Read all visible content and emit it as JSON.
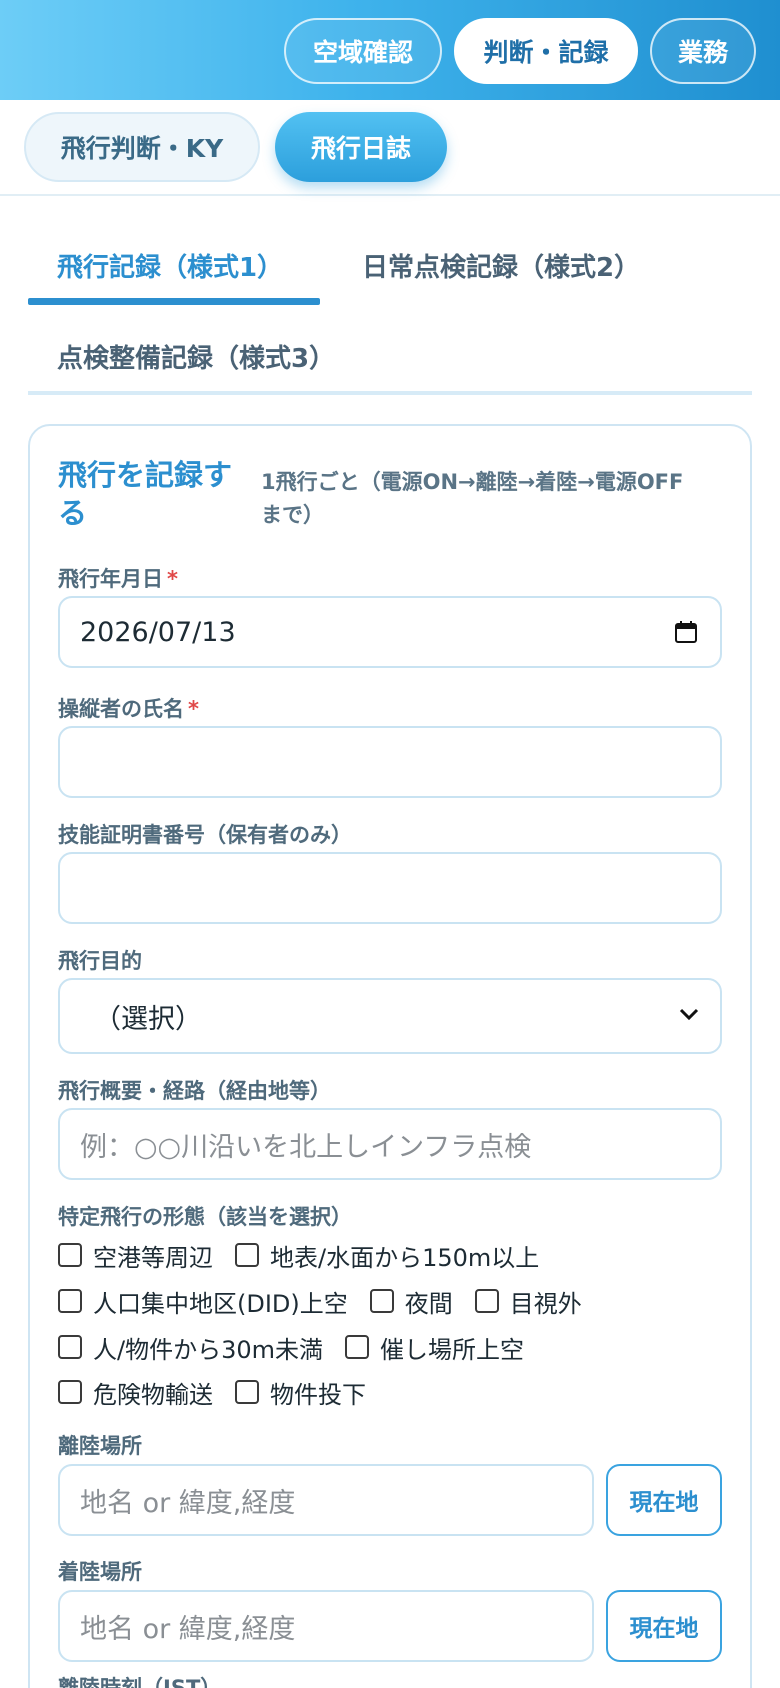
{
  "header": {
    "nav": [
      "空域確認",
      "判断・記録",
      "業務"
    ],
    "active_index": 1
  },
  "subnav": {
    "tabs": [
      "飛行判断・KY",
      "飛行日誌"
    ],
    "active_index": 1
  },
  "record_tabs": {
    "tabs": [
      "飛行記録（様式1）",
      "日常点検記録（様式2）",
      "点検整備記録（様式3）"
    ],
    "active_index": 0
  },
  "form": {
    "title": "飛行を記録する",
    "subtitle": "1飛行ごと（電源ON→離陸→着陸→電源OFFまで）",
    "flight_date": {
      "label": "飛行年月日",
      "value": "2026/07/13",
      "required": true
    },
    "pilot_name": {
      "label": "操縦者の氏名",
      "value": "",
      "required": true
    },
    "license_no": {
      "label": "技能証明書番号（保有者のみ）",
      "value": ""
    },
    "purpose": {
      "label": "飛行目的",
      "selected": "（選択）"
    },
    "route": {
      "label": "飛行概要・経路（経由地等）",
      "placeholder": "例：○○川沿いを北上しインフラ点検"
    },
    "specific_flight": {
      "label": "特定飛行の形態（該当を選択）",
      "options": [
        "空港等周辺",
        "地表/水面から150m以上",
        "人口集中地区(DID)上空",
        "夜間",
        "目視外",
        "人/物件から30m未満",
        "催し場所上空",
        "危険物輸送",
        "物件投下"
      ]
    },
    "takeoff": {
      "label": "離陸場所",
      "placeholder": "地名 or 緯度,経度",
      "button": "現在地"
    },
    "landing": {
      "label": "着陸場所",
      "placeholder": "地名 or 緯度,経度",
      "button": "現在地"
    },
    "next_label": "離陸時刻（JST）"
  },
  "colors": {
    "accent": "#2c8fcf",
    "required": "#e04848",
    "border": "#c9e3f2"
  }
}
